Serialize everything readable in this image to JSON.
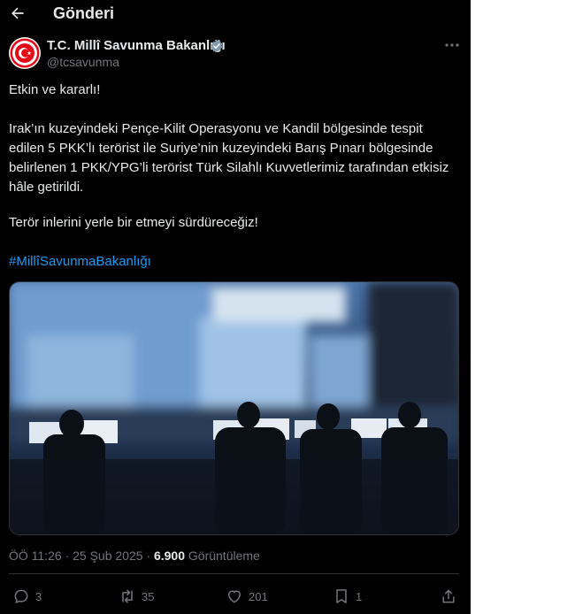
{
  "header": {
    "title": "Gönderi"
  },
  "author": {
    "name": "T.C. Millî Savunma Bakanlığı",
    "handle": "@tcsavunma"
  },
  "tweet": {
    "line1": "Etkin ve kararlı!",
    "paragraph2": "Irak’ın kuzeyindeki Pençe-Kilit Operasyonu ve Kandil bölgesinde tespit edilen 5 PKK’lı terörist ile Suriye’nin kuzeyindeki Barış Pınarı bölgesinde belirlenen 1 PKK/YPG’li terörist Türk Silahlı Kuvvetlerimiz tarafından etkisiz hâle getirildi.",
    "line3": "Terör inlerini yerle bir etmeyi sürdüreceğiz!",
    "hashtag": "#MillîSavunmaBakanlığı"
  },
  "meta": {
    "time": "ÖÖ 11:26 · 25 Şub 2025 · ",
    "views": "6.900",
    "views_label": " Görüntüleme"
  },
  "actions": {
    "replies": "3",
    "reposts": "35",
    "likes": "201",
    "bookmarks": "1"
  },
  "colors": {
    "background": "#000000",
    "text": "#e7e9ea",
    "secondary": "#71767b",
    "accent": "#1d9bf0",
    "emblem": "#e30a17"
  }
}
